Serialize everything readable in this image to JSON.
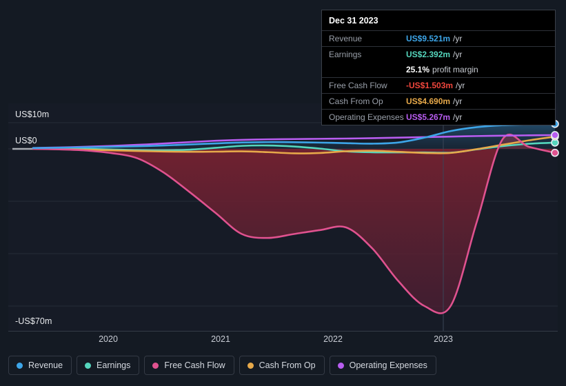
{
  "chart_data": {
    "type": "area",
    "title": "",
    "xlabel": "",
    "ylabel": "",
    "currency": "USD",
    "units": "millions",
    "ylim": [
      -70,
      15
    ],
    "grid": true,
    "legend_position": "bottom",
    "x_ticks": [
      "2020",
      "2021",
      "2022",
      "2023"
    ],
    "y_ticks": [
      "US$10m",
      "US$0",
      "-US$70m"
    ],
    "y_tick_values": [
      10,
      0,
      -70
    ],
    "series": [
      {
        "name": "Revenue",
        "color": "#3da5e8",
        "last_value": 9.521,
        "points": [
          [
            2019.0,
            0.3
          ],
          [
            2019.25,
            0.45
          ],
          [
            2019.5,
            0.6
          ],
          [
            2019.75,
            0.8
          ],
          [
            2020.0,
            1.0
          ],
          [
            2020.25,
            1.3
          ],
          [
            2020.5,
            1.7
          ],
          [
            2020.75,
            2.1
          ],
          [
            2021.0,
            2.45
          ],
          [
            2021.25,
            2.6
          ],
          [
            2021.5,
            2.55
          ],
          [
            2021.75,
            2.4
          ],
          [
            2022.0,
            2.2
          ],
          [
            2022.25,
            2.0
          ],
          [
            2022.5,
            2.45
          ],
          [
            2022.75,
            4.3
          ],
          [
            2023.0,
            6.8
          ],
          [
            2023.25,
            8.3
          ],
          [
            2023.5,
            9.05
          ],
          [
            2023.75,
            9.35
          ],
          [
            2024.0,
            9.521
          ]
        ]
      },
      {
        "name": "Earnings",
        "color": "#55d6bd",
        "last_value": 2.392,
        "profit_margin": "25.1%",
        "points": [
          [
            2019.0,
            0.1
          ],
          [
            2019.25,
            0.1
          ],
          [
            2019.5,
            0.0
          ],
          [
            2019.75,
            -0.2
          ],
          [
            2020.0,
            -0.45
          ],
          [
            2020.25,
            -0.5
          ],
          [
            2020.5,
            -0.3
          ],
          [
            2020.75,
            0.4
          ],
          [
            2021.0,
            1.15
          ],
          [
            2021.25,
            1.3
          ],
          [
            2021.5,
            0.9
          ],
          [
            2021.75,
            0.1
          ],
          [
            2022.0,
            -0.95
          ],
          [
            2022.25,
            -1.3
          ],
          [
            2022.5,
            -1.35
          ],
          [
            2022.75,
            -1.35
          ],
          [
            2023.0,
            -1.45
          ],
          [
            2023.25,
            -0.2
          ],
          [
            2023.5,
            1.05
          ],
          [
            2023.75,
            1.95
          ],
          [
            2024.0,
            2.392
          ]
        ]
      },
      {
        "name": "Free Cash Flow",
        "color": "#e0528f",
        "last_value": -1.503,
        "points": [
          [
            2019.0,
            0.0
          ],
          [
            2019.25,
            -0.2
          ],
          [
            2019.5,
            -0.6
          ],
          [
            2019.75,
            -1.6
          ],
          [
            2020.0,
            -3.6
          ],
          [
            2020.25,
            -9.0
          ],
          [
            2020.5,
            -16.5
          ],
          [
            2020.75,
            -24.5
          ],
          [
            2021.0,
            -32.5
          ],
          [
            2021.25,
            -34.0
          ],
          [
            2021.5,
            -32.5
          ],
          [
            2021.75,
            -31.0
          ],
          [
            2022.0,
            -30.0
          ],
          [
            2022.25,
            -38.0
          ],
          [
            2022.5,
            -50.5
          ],
          [
            2022.75,
            -60.0
          ],
          [
            2023.0,
            -60.0
          ],
          [
            2023.25,
            -28.0
          ],
          [
            2023.5,
            3.8
          ],
          [
            2023.75,
            0.8
          ],
          [
            2024.0,
            -1.503
          ]
        ]
      },
      {
        "name": "Cash From Op",
        "color": "#e7a94a",
        "last_value": 4.69,
        "points": [
          [
            2019.0,
            0.05
          ],
          [
            2019.25,
            -0.1
          ],
          [
            2019.5,
            -0.3
          ],
          [
            2019.75,
            -0.55
          ],
          [
            2020.0,
            -0.8
          ],
          [
            2020.25,
            -1.0
          ],
          [
            2020.5,
            -1.1
          ],
          [
            2020.75,
            -1.05
          ],
          [
            2021.0,
            -0.95
          ],
          [
            2021.25,
            -1.25
          ],
          [
            2021.5,
            -1.7
          ],
          [
            2021.75,
            -1.55
          ],
          [
            2022.0,
            -0.9
          ],
          [
            2022.25,
            -0.75
          ],
          [
            2022.5,
            -1.1
          ],
          [
            2022.75,
            -1.55
          ],
          [
            2023.0,
            -1.55
          ],
          [
            2023.25,
            -0.1
          ],
          [
            2023.5,
            1.6
          ],
          [
            2023.75,
            3.25
          ],
          [
            2024.0,
            4.69
          ]
        ]
      },
      {
        "name": "Operating Expenses",
        "color": "#b85df0",
        "last_value": 5.267,
        "points": [
          [
            2019.0,
            0.35
          ],
          [
            2019.25,
            0.55
          ],
          [
            2019.5,
            0.8
          ],
          [
            2019.75,
            1.15
          ],
          [
            2020.0,
            1.55
          ],
          [
            2020.25,
            2.05
          ],
          [
            2020.5,
            2.6
          ],
          [
            2020.75,
            3.1
          ],
          [
            2021.0,
            3.45
          ],
          [
            2021.25,
            3.65
          ],
          [
            2021.5,
            3.75
          ],
          [
            2021.75,
            3.85
          ],
          [
            2022.0,
            3.95
          ],
          [
            2022.25,
            4.1
          ],
          [
            2022.5,
            4.3
          ],
          [
            2022.75,
            4.5
          ],
          [
            2023.0,
            4.7
          ],
          [
            2023.25,
            4.9
          ],
          [
            2023.5,
            5.05
          ],
          [
            2023.75,
            5.18
          ],
          [
            2024.0,
            5.267
          ]
        ]
      }
    ]
  },
  "tooltip": {
    "date": "Dec 31 2023",
    "rows": [
      {
        "label": "Revenue",
        "value": "US$9.521m",
        "unit": "/yr",
        "color": "#3da5e8"
      },
      {
        "label": "Earnings",
        "value": "US$2.392m",
        "unit": "/yr",
        "color": "#55d6bd"
      },
      {
        "label": "",
        "value": "25.1%",
        "unit": "profit margin",
        "color": "#ffffff"
      },
      {
        "label": "Free Cash Flow",
        "value": "-US$1.503m",
        "unit": "/yr",
        "color": "#f0463c"
      },
      {
        "label": "Cash From Op",
        "value": "US$4.690m",
        "unit": "/yr",
        "color": "#e7a94a"
      },
      {
        "label": "Operating Expenses",
        "value": "US$5.267m",
        "unit": "/yr",
        "color": "#b85df0"
      }
    ]
  },
  "legend": {
    "items": [
      {
        "label": "Revenue",
        "color": "#3da5e8"
      },
      {
        "label": "Earnings",
        "color": "#55d6bd"
      },
      {
        "label": "Free Cash Flow",
        "color": "#e0528f"
      },
      {
        "label": "Cash From Op",
        "color": "#e7a94a"
      },
      {
        "label": "Operating Expenses",
        "color": "#b85df0"
      }
    ]
  },
  "axes": {
    "y_labels": [
      {
        "text": "US$10m",
        "value": 10
      },
      {
        "text": "US$0",
        "value": 0
      },
      {
        "text": "-US$70m",
        "value": -70
      }
    ],
    "x_labels": [
      "2020",
      "2021",
      "2022",
      "2023"
    ]
  },
  "colors": {
    "background": "#141a23",
    "plot_background": "#161b26",
    "grid": "#272d38",
    "zero_line": "#a8acb3",
    "cursor_line": "#3a4456",
    "tooltip_bg": "#000000",
    "tooltip_border": "#3a3f48"
  }
}
